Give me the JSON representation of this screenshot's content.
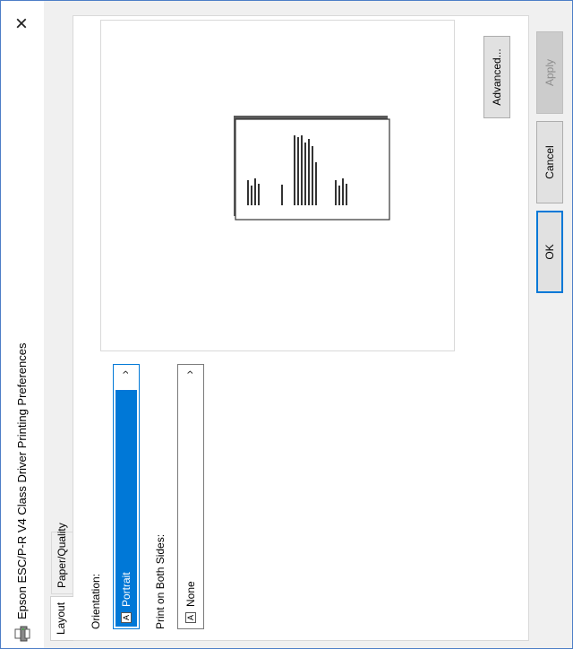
{
  "window": {
    "title": "Epson ESC/P-R V4 Class Driver Printing Preferences",
    "close_symbol": "×",
    "icon": "printer-icon",
    "accent_color": "#0078d7"
  },
  "tabs": [
    {
      "label": "Layout",
      "active": true
    },
    {
      "label": "Paper/Quality",
      "active": false
    }
  ],
  "layout": {
    "orientation_label": "Orientation:",
    "orientation_value": "Portrait",
    "orientation_icon": "A",
    "duplex_label": "Print on Both Sides:",
    "duplex_value": "None",
    "duplex_icon": "A",
    "dropdown_chevron": "›",
    "advanced_label": "Advanced..."
  },
  "buttons": {
    "ok": "OK",
    "cancel": "Cancel",
    "apply": "Apply"
  }
}
